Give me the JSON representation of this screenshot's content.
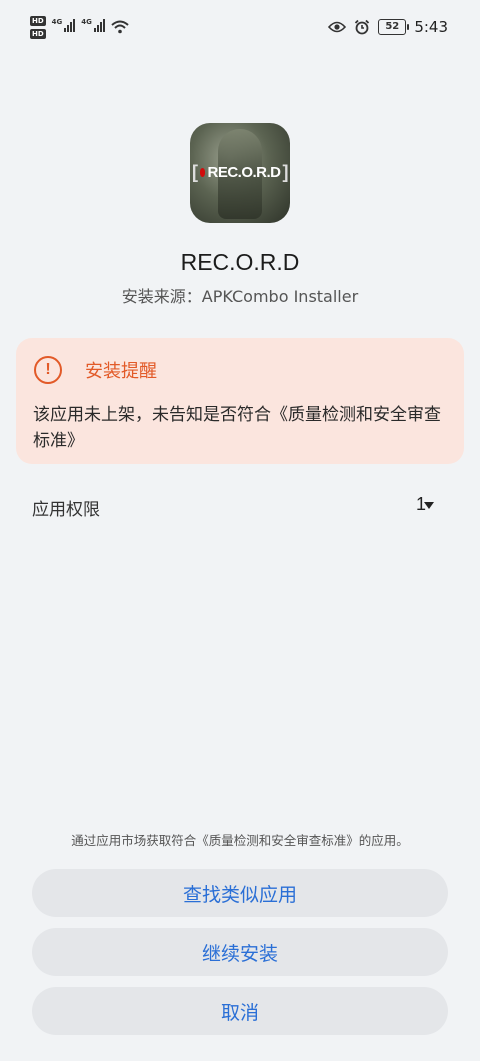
{
  "status_bar": {
    "hd1": "HD",
    "hd2": "HD",
    "sim1_net": "4G",
    "sim2_net": "4G",
    "battery": "52",
    "time": "5:43",
    "icons": [
      "signal-icon",
      "wifi-icon",
      "eye-icon",
      "alarm-icon",
      "battery-icon"
    ]
  },
  "app": {
    "icon_text": "REC.O.R.D",
    "name": "REC.O.R.D",
    "source": "安装来源：APKCombo Installer"
  },
  "warning": {
    "title": "安装提醒",
    "body": "该应用未上架，未告知是否符合《质量检测和安全审查标准》",
    "color": "#e25a28",
    "background": "#fbe5de"
  },
  "permissions": {
    "label": "应用权限",
    "count": "1"
  },
  "footer": {
    "note": "通过应用市场获取符合《质量检测和安全审查标准》的应用。",
    "find_similar": "查找类似应用",
    "continue_install": "继续安装",
    "cancel": "取消",
    "button_text_color": "#2a6fd6"
  }
}
